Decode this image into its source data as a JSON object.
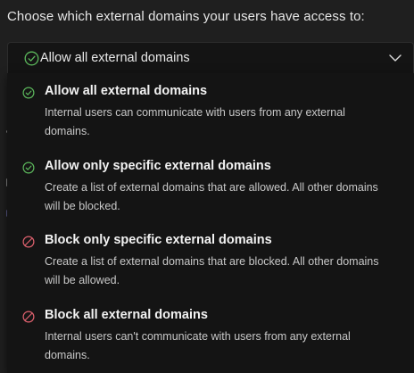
{
  "heading": "Choose which external domains your users have access to:",
  "select": {
    "value": "Allow all external domains",
    "icon": "check-circle-icon",
    "chevron_icon": "chevron-down-icon"
  },
  "options": [
    {
      "title": "Allow all external domains",
      "description": "Internal users can communicate with users from any external domains.",
      "icon": "check-circle-icon",
      "icon_color": "#5cb85c"
    },
    {
      "title": "Allow only specific external domains",
      "description": "Create a list of external domains that are allowed. All other domains will be blocked.",
      "icon": "check-circle-icon",
      "icon_color": "#5cb85c"
    },
    {
      "title": "Block only specific external domains",
      "description": "Create a list of external domains that are blocked. All other domains will be allowed.",
      "icon": "block-circle-icon",
      "icon_color": "#e0626f"
    },
    {
      "title": "Block all external domains",
      "description": "Internal users can't communicate with users from any external domains.",
      "icon": "block-circle-icon",
      "icon_color": "#e0626f"
    }
  ],
  "colors": {
    "background": "#1f1f1f",
    "dropdown_background": "#141414",
    "allow_icon": "#5cb85c",
    "block_icon": "#e0626f"
  }
}
